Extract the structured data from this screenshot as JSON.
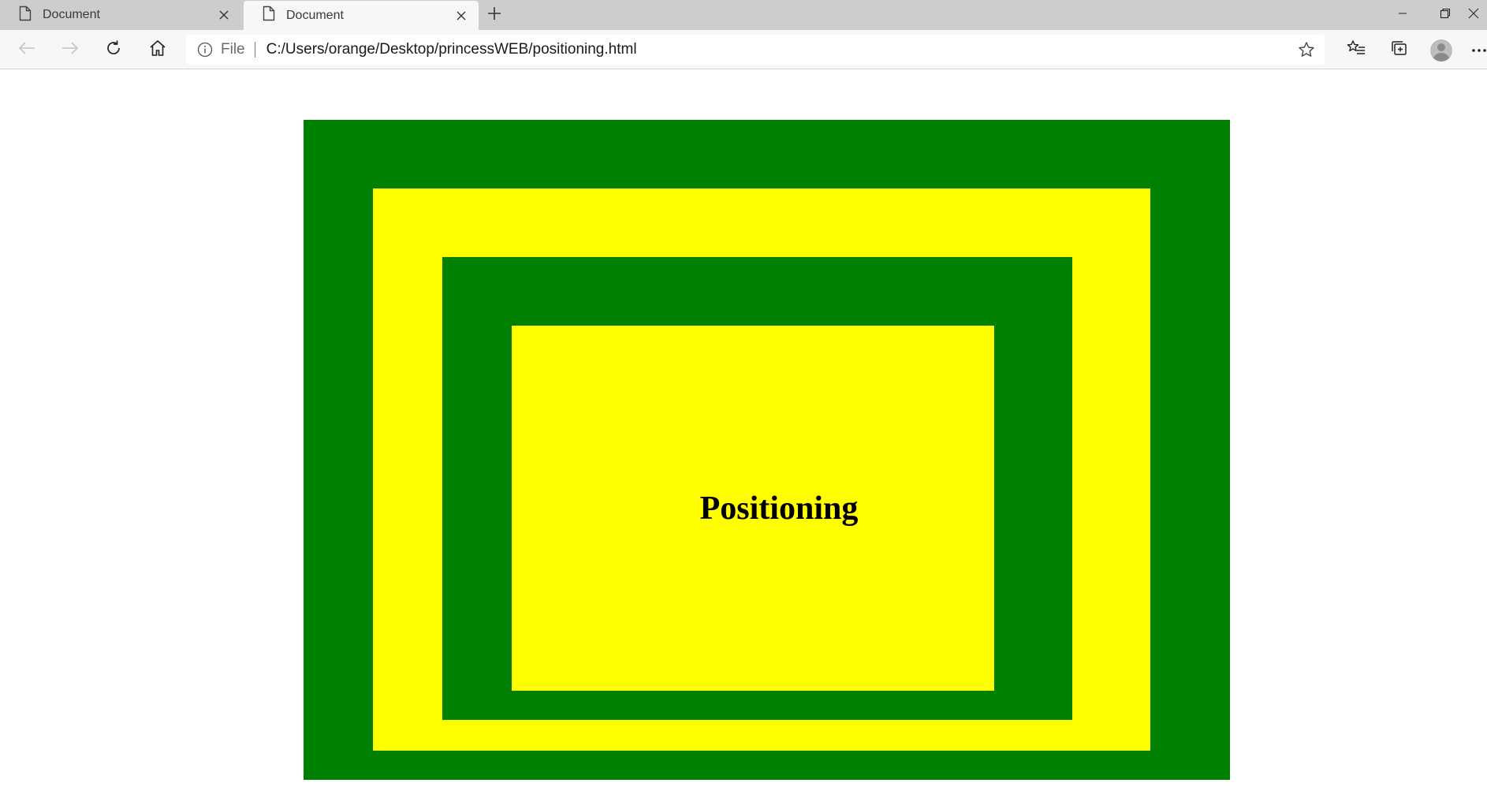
{
  "browser": {
    "tabs": [
      {
        "title": "Document",
        "active": false
      },
      {
        "title": "Document",
        "active": true
      }
    ],
    "address_bar": {
      "scheme_label": "File",
      "url": "C:/Users/orange/Desktop/princessWEB/positioning.html"
    },
    "icons": {
      "tab_page": "page-icon",
      "tab_close": "close-icon",
      "new_tab": "plus-icon",
      "back": "arrow-left-icon",
      "forward": "arrow-right-icon",
      "refresh": "refresh-icon",
      "home": "home-icon",
      "info": "info-icon",
      "favorite": "star-icon",
      "favorites": "favorites-list-icon",
      "collections": "collections-icon",
      "profile": "profile-avatar-icon",
      "menu": "more-icon"
    }
  },
  "page": {
    "heading": "Positioning",
    "colors": {
      "green": "#008000",
      "yellow": "#ffff00"
    }
  }
}
